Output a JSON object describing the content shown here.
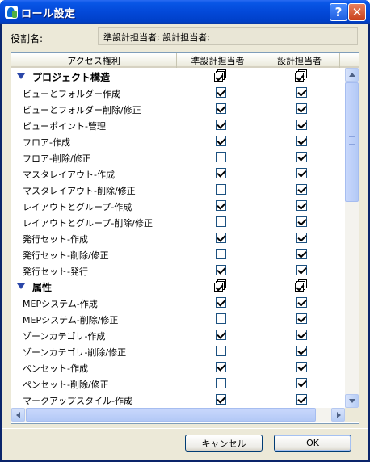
{
  "window": {
    "title": "ロール設定",
    "help_label": "?",
    "close_label": "✕"
  },
  "role": {
    "label": "役割名:",
    "value": "準設計担当者; 設計担当者;"
  },
  "table": {
    "columns": [
      "アクセス権利",
      "準設計担当者",
      "設計担当者"
    ],
    "rows": [
      {
        "type": "group",
        "name": "プロジェクト構造"
      },
      {
        "type": "item",
        "name": "ビューとフォルダー作成",
        "a": true,
        "b": true
      },
      {
        "type": "item",
        "name": "ビューとフォルダー削除/修正",
        "a": true,
        "b": true
      },
      {
        "type": "item",
        "name": "ビューポイント-管理",
        "a": true,
        "b": true
      },
      {
        "type": "item",
        "name": "フロア-作成",
        "a": true,
        "b": true
      },
      {
        "type": "item",
        "name": "フロア-削除/修正",
        "a": false,
        "b": true
      },
      {
        "type": "item",
        "name": "マスタレイアウト-作成",
        "a": true,
        "b": true
      },
      {
        "type": "item",
        "name": "マスタレイアウト-削除/修正",
        "a": false,
        "b": true
      },
      {
        "type": "item",
        "name": "レイアウトとグループ-作成",
        "a": true,
        "b": true
      },
      {
        "type": "item",
        "name": "レイアウトとグループ-削除/修正",
        "a": false,
        "b": true
      },
      {
        "type": "item",
        "name": "発行セット-作成",
        "a": true,
        "b": true
      },
      {
        "type": "item",
        "name": "発行セット-削除/修正",
        "a": false,
        "b": true
      },
      {
        "type": "item",
        "name": "発行セット-発行",
        "a": true,
        "b": true
      },
      {
        "type": "group",
        "name": "属性"
      },
      {
        "type": "item",
        "name": "MEPシステム-作成",
        "a": true,
        "b": true
      },
      {
        "type": "item",
        "name": "MEPシステム-削除/修正",
        "a": false,
        "b": true
      },
      {
        "type": "item",
        "name": "ゾーンカテゴリ-作成",
        "a": true,
        "b": true
      },
      {
        "type": "item",
        "name": "ゾーンカテゴリ-削除/修正",
        "a": false,
        "b": true
      },
      {
        "type": "item",
        "name": "ペンセット-作成",
        "a": true,
        "b": true
      },
      {
        "type": "item",
        "name": "ペンセット-削除/修正",
        "a": false,
        "b": true
      },
      {
        "type": "item",
        "name": "マークアップスタイル-作成",
        "a": true,
        "b": true
      }
    ]
  },
  "buttons": {
    "cancel": "キャンセル",
    "ok": "OK"
  }
}
